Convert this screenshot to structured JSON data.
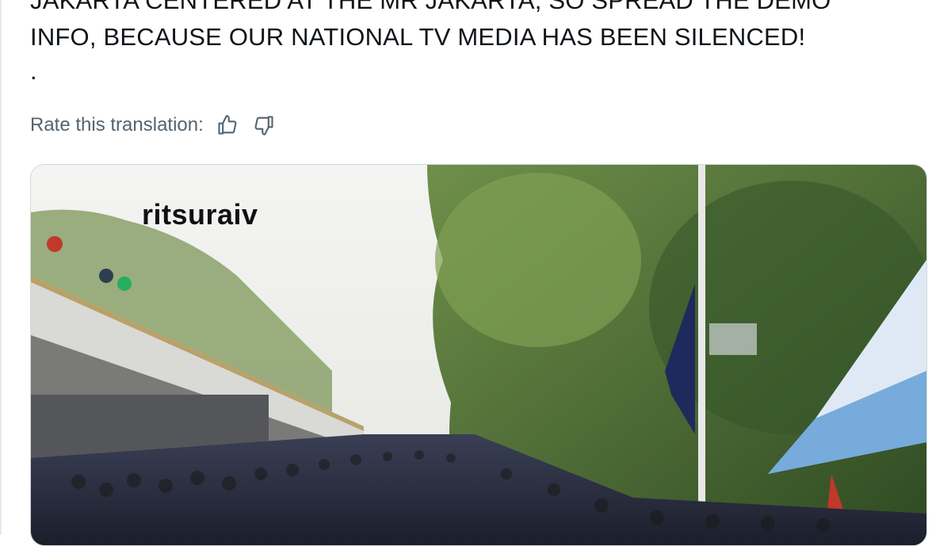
{
  "tweet": {
    "lines": [
      "JAKARTA CENTERED AT THE MR JAKARTA, SO SPREAD THE DEMO",
      "INFO, BECAUSE OUR NATIONAL TV MEDIA HAS BEEN SILENCED!"
    ],
    "dot": "."
  },
  "translation": {
    "label": "Rate this translation:",
    "thumbs_up_icon": "thumbs-up-icon",
    "thumbs_down_icon": "thumbs-down-icon"
  },
  "media": {
    "watermark": "ritsuraiv"
  },
  "colors": {
    "text": "#0f1419",
    "muted": "#536471",
    "border": "#cfd9de"
  }
}
